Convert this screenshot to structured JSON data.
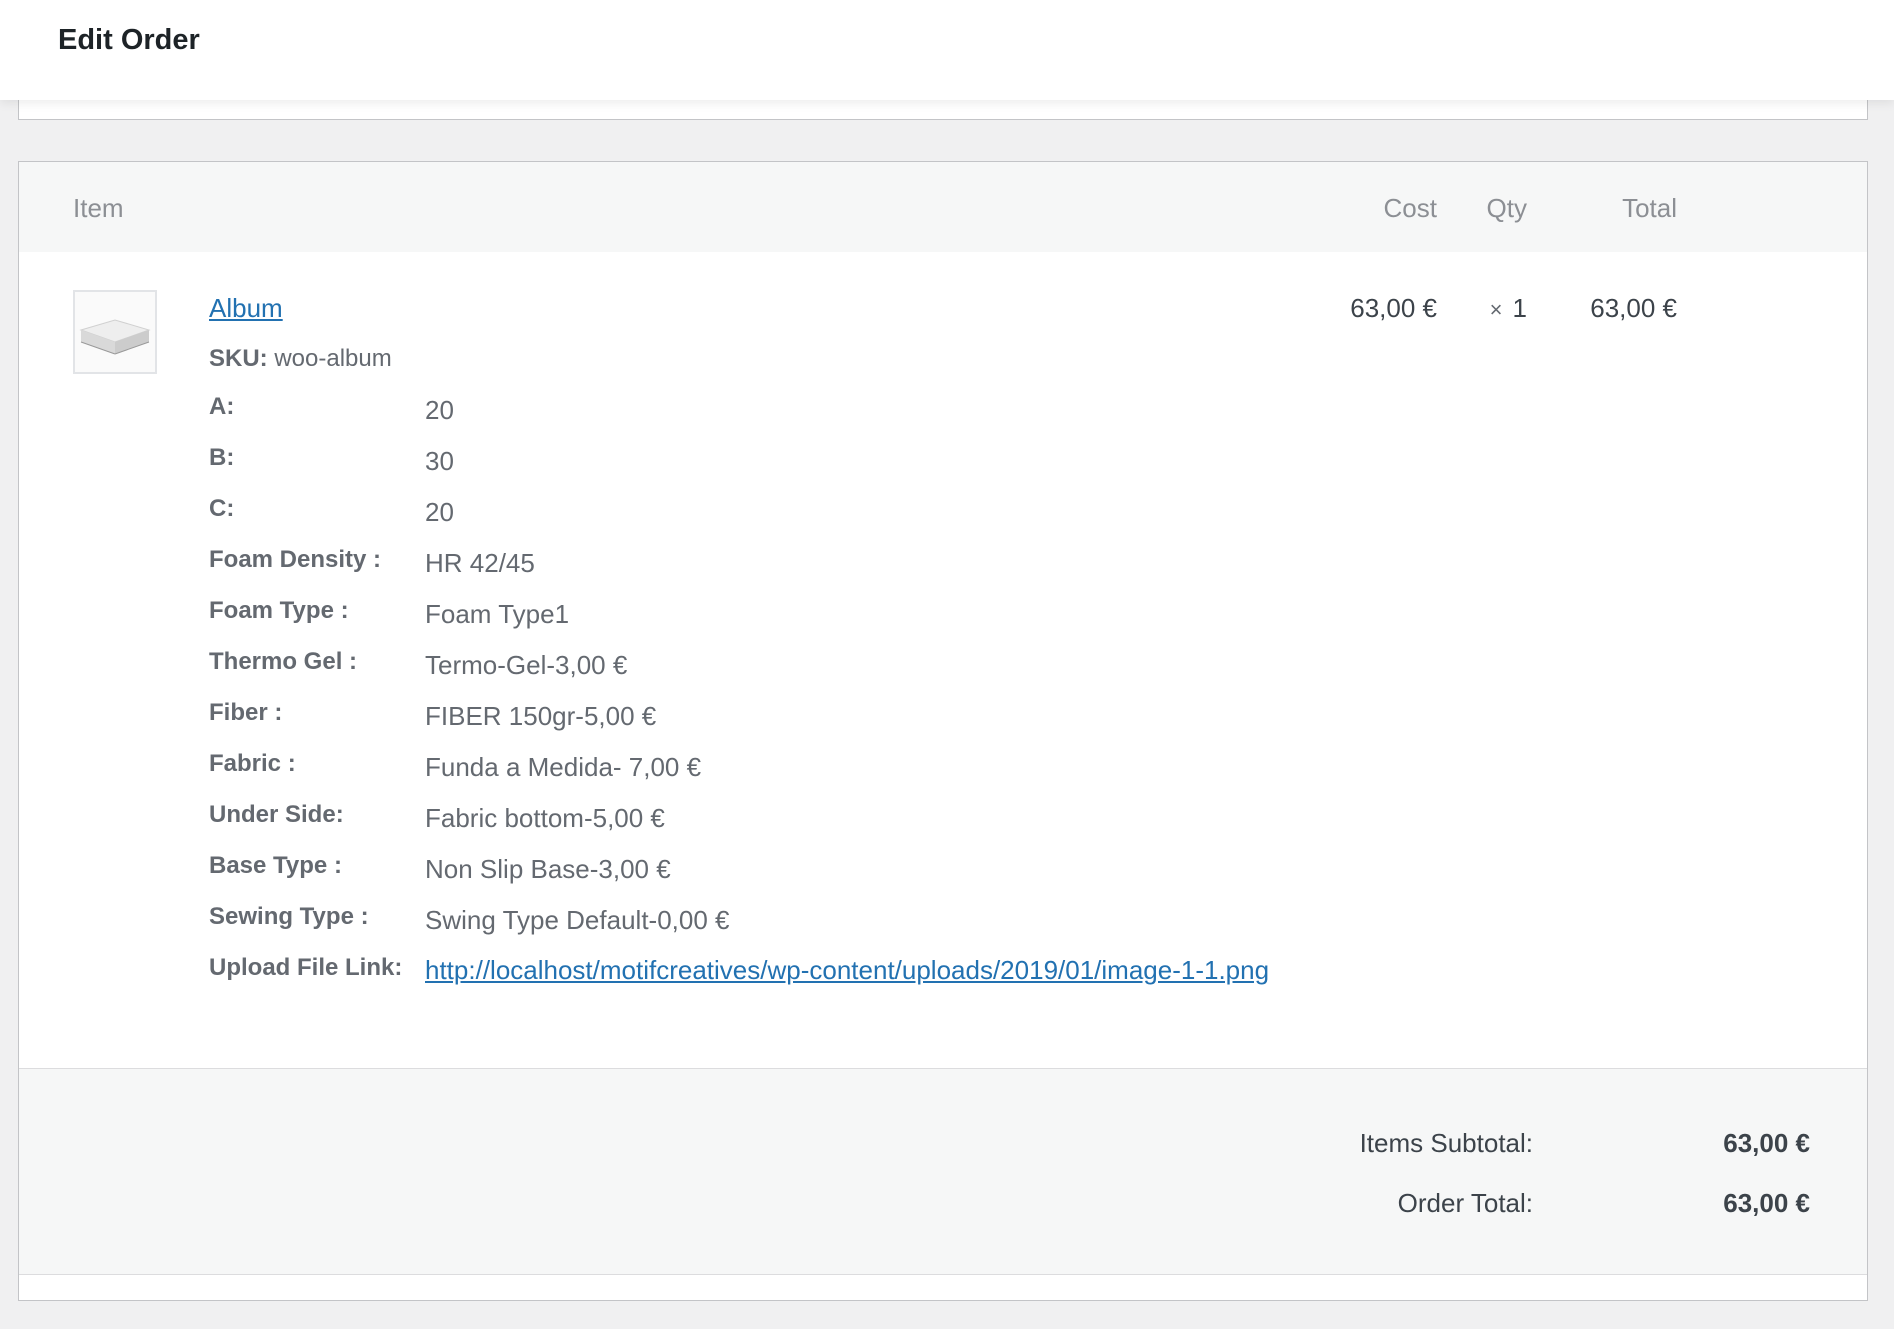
{
  "header": {
    "title": "Edit Order"
  },
  "table": {
    "columns": {
      "item": "Item",
      "cost": "Cost",
      "qty": "Qty",
      "total": "Total"
    }
  },
  "item": {
    "name": "Album",
    "sku_label": "SKU:",
    "sku_value": "woo-album",
    "cost": "63,00 €",
    "qty_symbol": "×",
    "qty": "1",
    "total": "63,00 €",
    "meta": [
      {
        "key": "A:",
        "value": "20"
      },
      {
        "key": "B:",
        "value": "30"
      },
      {
        "key": "C:",
        "value": "20"
      },
      {
        "key": "Foam Density :",
        "value": "HR 42/45"
      },
      {
        "key": "Foam Type :",
        "value": "Foam Type1"
      },
      {
        "key": "Thermo Gel :",
        "value": "Termo-Gel-3,00 €"
      },
      {
        "key": "Fiber :",
        "value": "FIBER 150gr-5,00 €"
      },
      {
        "key": "Fabric :",
        "value": "Funda a Medida- 7,00 €"
      },
      {
        "key": "Under Side:",
        "value": "Fabric bottom-5,00 €"
      },
      {
        "key": "Base Type :",
        "value": "Non Slip Base-3,00 €"
      },
      {
        "key": "Sewing Type :",
        "value": "Swing Type Default-0,00 €"
      }
    ],
    "upload": {
      "key": "Upload File Link:",
      "url": "http://localhost/motifcreatives/wp-content/uploads/2019/01/image-1-1.png"
    }
  },
  "totals": {
    "subtotal_label": "Items Subtotal:",
    "subtotal_value": "63,00 €",
    "order_total_label": "Order Total:",
    "order_total_value": "63,00 €"
  }
}
